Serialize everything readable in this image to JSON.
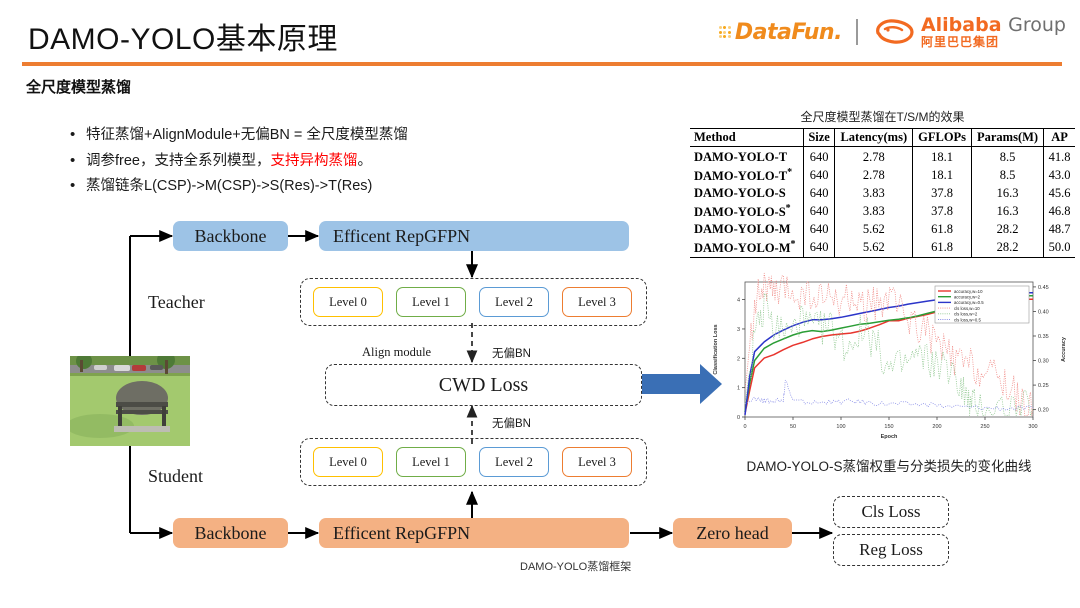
{
  "header": {
    "title": "DAMO-YOLO基本原理",
    "section_title": "全尺度模型蒸馏",
    "accent_color": "#ED7D31"
  },
  "logos": {
    "datafun": "DataFun.",
    "alibaba_en": "Alibaba",
    "alibaba_group": "Group",
    "alibaba_cn": "阿里巴巴集团"
  },
  "bullets": [
    {
      "marker": "•",
      "text": "特征蒸馏+AlignModule+无偏BN = 全尺度模型蒸馏",
      "highlight": ""
    },
    {
      "marker": "•",
      "pre": "调参free，支持全系列模型，",
      "highlight": "支持异构蒸馏",
      "post": "。"
    },
    {
      "marker": "•",
      "text": "蒸馏链条L(CSP)->M(CSP)->S(Res)->T(Res)",
      "highlight": ""
    }
  ],
  "table": {
    "caption": "全尺度模型蒸馏在T/S/M的效果",
    "columns": [
      "Method",
      "Size",
      "Latency(ms)",
      "GFLOPs",
      "Params(M)",
      "AP"
    ],
    "rows": [
      {
        "method": "DAMO-YOLO-T",
        "star": false,
        "size": "640",
        "latency": "2.78",
        "gflops": "18.1",
        "params": "8.5",
        "ap": "41.8"
      },
      {
        "method": "DAMO-YOLO-T",
        "star": true,
        "size": "640",
        "latency": "2.78",
        "gflops": "18.1",
        "params": "8.5",
        "ap": "43.0"
      },
      {
        "method": "DAMO-YOLO-S",
        "star": false,
        "size": "640",
        "latency": "3.83",
        "gflops": "37.8",
        "params": "16.3",
        "ap": "45.6"
      },
      {
        "method": "DAMO-YOLO-S",
        "star": true,
        "size": "640",
        "latency": "3.83",
        "gflops": "37.8",
        "params": "16.3",
        "ap": "46.8"
      },
      {
        "method": "DAMO-YOLO-M",
        "star": false,
        "size": "640",
        "latency": "5.62",
        "gflops": "61.8",
        "params": "28.2",
        "ap": "48.7"
      },
      {
        "method": "DAMO-YOLO-M",
        "star": true,
        "size": "640",
        "latency": "5.62",
        "gflops": "61.8",
        "params": "28.2",
        "ap": "50.0"
      }
    ]
  },
  "chart_caption": "DAMO-YOLO-S蒸馏权重与分类损失的变化曲线",
  "chart_data": {
    "type": "line",
    "title": "",
    "xlabel": "Epoch",
    "ylabel": "Classification Loss",
    "y2label": "Accuracy",
    "xlim": [
      0,
      300
    ],
    "ylim": [
      0,
      4.6
    ],
    "y2lim": [
      0.185,
      0.46
    ],
    "xticks": [
      0,
      50,
      100,
      150,
      200,
      250,
      300
    ],
    "yticks": [
      0,
      1,
      2,
      3,
      4
    ],
    "y2ticks": [
      0.2,
      0.25,
      0.3,
      0.35,
      0.4,
      0.45
    ],
    "grid": false,
    "legend_position": "upper right",
    "legend": [
      "accuracy,w=10",
      "accuracy,w=2",
      "accuracy,w=0.5",
      "cls loss,w=10",
      "cls loss,w=2",
      "cls loss,w=0.5"
    ],
    "series": [
      {
        "name": "accuracy,w=10",
        "axis": "right",
        "style": "solid",
        "color": "#e8352e",
        "x": [
          0,
          5,
          10,
          20,
          30,
          40,
          50,
          60,
          70,
          80,
          90,
          100,
          110,
          120,
          130,
          140,
          150,
          160,
          170,
          180,
          190,
          200,
          210,
          220,
          230,
          240,
          250,
          260,
          270,
          280,
          290,
          300
        ],
        "y": [
          0.192,
          0.24,
          0.285,
          0.305,
          0.312,
          0.322,
          0.331,
          0.337,
          0.344,
          0.349,
          0.352,
          0.354,
          0.356,
          0.36,
          0.366,
          0.373,
          0.381,
          0.381,
          0.386,
          0.39,
          0.394,
          0.399,
          0.404,
          0.408,
          0.412,
          0.416,
          0.419,
          0.421,
          0.423,
          0.424,
          0.425,
          0.425
        ]
      },
      {
        "name": "accuracy,w=2",
        "axis": "right",
        "style": "solid",
        "color": "#2a9d35",
        "x": [
          0,
          5,
          10,
          20,
          30,
          40,
          50,
          60,
          70,
          80,
          90,
          100,
          110,
          120,
          130,
          140,
          150,
          160,
          170,
          180,
          190,
          200,
          210,
          220,
          230,
          240,
          250,
          260,
          270,
          280,
          290,
          300
        ],
        "y": [
          0.195,
          0.255,
          0.3,
          0.325,
          0.336,
          0.344,
          0.352,
          0.358,
          0.361,
          0.359,
          0.362,
          0.366,
          0.37,
          0.374,
          0.376,
          0.379,
          0.382,
          0.384,
          0.387,
          0.391,
          0.396,
          0.401,
          0.406,
          0.411,
          0.416,
          0.42,
          0.424,
          0.427,
          0.429,
          0.431,
          0.432,
          0.432
        ]
      },
      {
        "name": "accuracy,w=0.5",
        "axis": "right",
        "style": "solid",
        "color": "#2b35c9",
        "x": [
          0,
          5,
          10,
          20,
          30,
          40,
          50,
          60,
          70,
          80,
          90,
          100,
          110,
          120,
          130,
          140,
          150,
          160,
          170,
          180,
          190,
          200,
          210,
          220,
          230,
          240,
          250,
          260,
          270,
          280,
          290,
          300
        ],
        "y": [
          0.189,
          0.27,
          0.318,
          0.338,
          0.352,
          0.362,
          0.371,
          0.378,
          0.383,
          0.383,
          0.385,
          0.388,
          0.392,
          0.396,
          0.4,
          0.404,
          0.408,
          0.411,
          0.415,
          0.418,
          0.421,
          0.424,
          0.427,
          0.43,
          0.432,
          0.434,
          0.435,
          0.436,
          0.437,
          0.438,
          0.438,
          0.438
        ]
      },
      {
        "name": "cls loss,w=10",
        "axis": "left",
        "style": "dotted",
        "color": "#f08a86",
        "x": [
          0,
          10,
          20,
          30,
          40,
          55,
          70,
          85,
          100,
          115,
          130,
          145,
          160,
          175,
          190,
          205,
          220,
          235,
          250,
          265,
          280,
          290,
          300
        ],
        "y": [
          0.85,
          4.0,
          4.45,
          4.1,
          4.3,
          4.2,
          4.1,
          4.0,
          3.9,
          4.0,
          3.8,
          4.0,
          3.7,
          3.3,
          2.9,
          2.4,
          1.9,
          1.8,
          1.5,
          1.4,
          0.9,
          0.35,
          0.3
        ]
      },
      {
        "name": "cls loss,w=2",
        "axis": "left",
        "style": "dotted",
        "color": "#8fc78f",
        "x": [
          0,
          10,
          20,
          30,
          45,
          60,
          75,
          90,
          105,
          120,
          135,
          150,
          165,
          180,
          195,
          210,
          225,
          232,
          240,
          260,
          280,
          300
        ],
        "y": [
          0.5,
          2.6,
          3.7,
          3.1,
          2.9,
          3.2,
          3.0,
          3.1,
          2.4,
          2.9,
          2.6,
          1.6,
          1.8,
          2.1,
          1.9,
          1.5,
          1.2,
          0.5,
          0.4,
          0.35,
          0.32,
          0.3
        ]
      },
      {
        "name": "cls loss,w=0.5",
        "axis": "left",
        "style": "dotted",
        "color": "#8a8fe8",
        "x": [
          0,
          10,
          20,
          30,
          40,
          42,
          50,
          70,
          90,
          110,
          130,
          150,
          175,
          200,
          225,
          250,
          275,
          300
        ],
        "y": [
          0.45,
          0.6,
          0.55,
          0.55,
          0.55,
          1.25,
          0.55,
          0.5,
          0.5,
          0.55,
          0.5,
          0.45,
          0.45,
          0.4,
          0.35,
          0.32,
          0.3,
          0.3
        ]
      }
    ]
  },
  "diagram": {
    "caption": "DAMO-YOLO蒸馏框架",
    "teacher_label": "Teacher",
    "student_label": "Student",
    "teacher_backbone": "Backbone",
    "teacher_neck": "Efficent RepGFPN",
    "student_backbone": "Backbone",
    "student_neck": "Efficent RepGFPN",
    "levels": [
      "Level 0",
      "Level 1",
      "Level 2",
      "Level 3"
    ],
    "align_module": "Align module",
    "bn_top": "无偏BN",
    "bn_bottom": "无偏BN",
    "cwd_loss": "CWD Loss",
    "zero_head": "Zero head",
    "cls_loss": "Cls Loss",
    "reg_loss": "Reg Loss",
    "photo_alt": "park-bench-photo"
  }
}
